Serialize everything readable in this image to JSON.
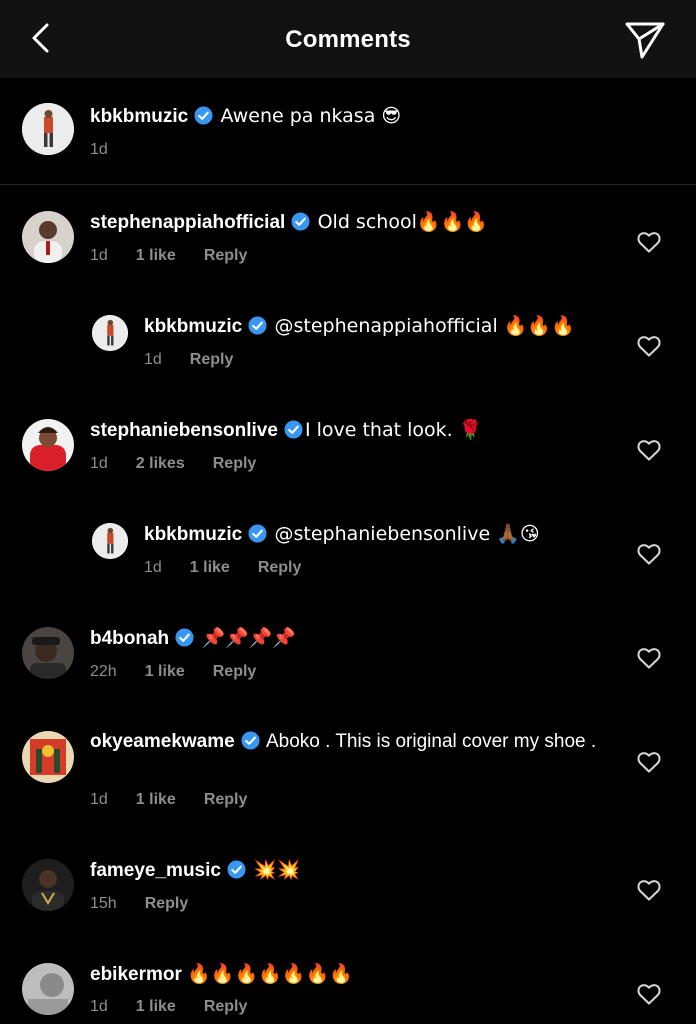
{
  "header": {
    "title": "Comments"
  },
  "caption": {
    "username": "kbkbmuzic",
    "text": "Awene pa nkasa 😎",
    "time": "1d"
  },
  "comments": [
    {
      "username": "stephenappiahofficial",
      "text": "Old school🔥🔥🔥",
      "time": "1d",
      "likes": "1 like",
      "reply": "Reply"
    },
    {
      "username": "kbkbmuzic",
      "text": "@stephenappiahofficial 🔥🔥🔥",
      "time": "1d",
      "likes": "",
      "reply": "Reply"
    },
    {
      "username": "stephaniebensonlive",
      "text": "I love that look. 🌹",
      "time": "1d",
      "likes": "2 likes",
      "reply": "Reply"
    },
    {
      "username": "kbkbmuzic",
      "text": "@stephaniebensonlive 🙏🏾😘",
      "time": "1d",
      "likes": "1 like",
      "reply": "Reply"
    },
    {
      "username": "b4bonah",
      "text": "📌📌📌📌",
      "time": "22h",
      "likes": "1 like",
      "reply": "Reply"
    },
    {
      "username": "okyeamekwame",
      "text": "Aboko . This is original cover my shoe .",
      "time": "1d",
      "likes": "1 like",
      "reply": "Reply"
    },
    {
      "username": "fameye_music",
      "text": "💥💥",
      "time": "15h",
      "likes": "",
      "reply": "Reply"
    },
    {
      "username": "ebikermor",
      "text": "🔥🔥🔥🔥🔥🔥🔥",
      "time": "1d",
      "likes": "1 like",
      "reply": "Reply"
    }
  ],
  "icons": {
    "back": "chevron-left-icon",
    "send": "send-icon",
    "verified": "verified-badge-icon",
    "like": "heart-icon"
  },
  "colors": {
    "verified": "#3897f0",
    "meta": "#8e8e8e",
    "header_bg": "#121212"
  }
}
